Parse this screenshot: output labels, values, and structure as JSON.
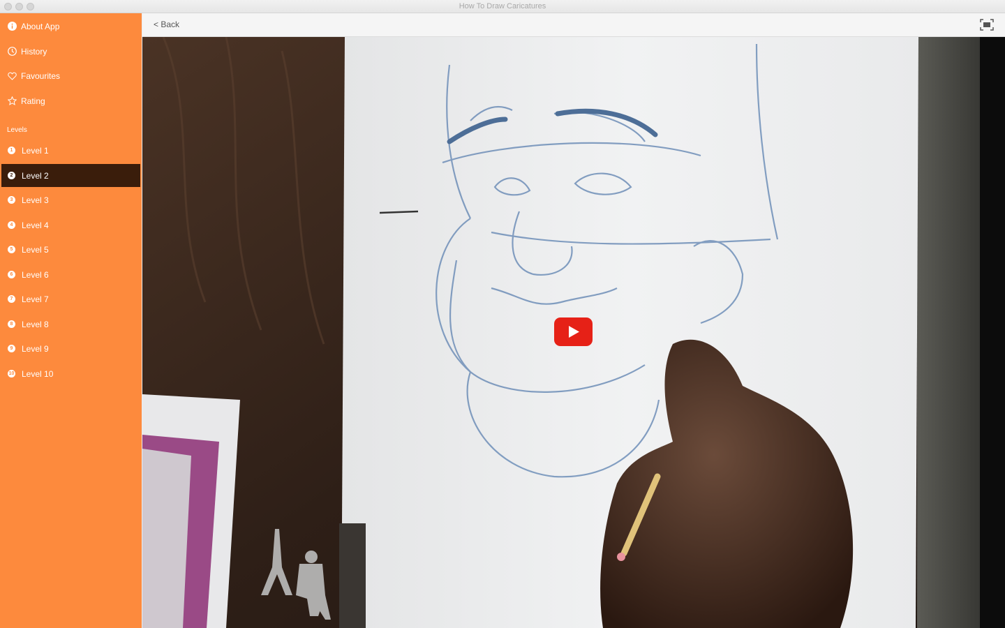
{
  "window": {
    "title": "How To Draw Caricatures"
  },
  "sidebar": {
    "menu": [
      {
        "label": "About App",
        "icon": "info-icon"
      },
      {
        "label": "History",
        "icon": "clock-icon"
      },
      {
        "label": "Favourites",
        "icon": "heart-icon"
      },
      {
        "label": "Rating",
        "icon": "star-icon"
      }
    ],
    "levels_header": "Levels",
    "levels": [
      {
        "label": "Level 1",
        "num": "1"
      },
      {
        "label": "Level 2",
        "num": "2"
      },
      {
        "label": "Level 3",
        "num": "3"
      },
      {
        "label": "Level 4",
        "num": "4"
      },
      {
        "label": "Level 5",
        "num": "5"
      },
      {
        "label": "Level 6",
        "num": "6"
      },
      {
        "label": "Level 7",
        "num": "7"
      },
      {
        "label": "Level 8",
        "num": "8"
      },
      {
        "label": "Level 9",
        "num": "9"
      },
      {
        "label": "Level 10",
        "num": "10"
      }
    ],
    "active_level": "Level 2"
  },
  "toolbar": {
    "back_label": "< Back"
  },
  "colors": {
    "sidebar_bg": "#fd8a3d",
    "active_bg": "#3a1d0b",
    "play_red": "#e62117"
  }
}
